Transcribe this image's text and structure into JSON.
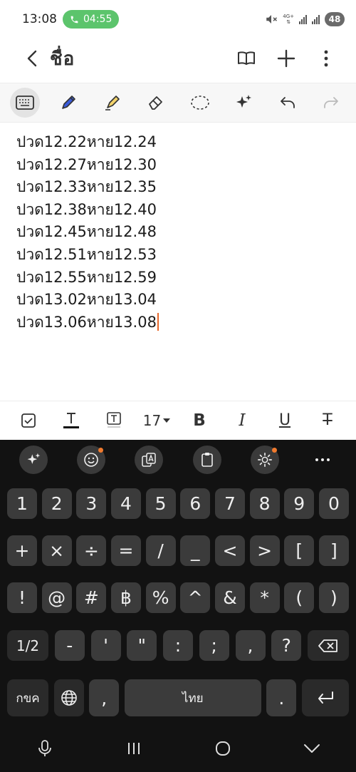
{
  "status_bar": {
    "time": "13:08",
    "call_timer": "04:55",
    "network": "4G+",
    "battery": "48"
  },
  "app_bar": {
    "title": "ชื่อ",
    "icons": [
      "back-icon",
      "book-icon",
      "plus-icon",
      "more-vertical-icon"
    ]
  },
  "pen_toolbar": {
    "tools": [
      "keyboard-icon",
      "pen-icon",
      "highlighter-icon",
      "eraser-icon",
      "lasso-icon",
      "ai-sparkle-icon",
      "undo-icon",
      "redo-icon"
    ],
    "active_tool": "keyboard-icon"
  },
  "note": {
    "lines": [
      "ปวด12.22หาย12.24",
      "ปวด12.27หาย12.30",
      "ปวด12.33หาย12.35",
      "ปวด12.38หาย12.40",
      "ปวด12.45หาย12.48",
      "ปวด12.51หาย12.53",
      "ปวด12.55หาย12.59",
      "ปวด13.02หาย13.04",
      "ปวด13.06หาย13.08"
    ],
    "cursor_color": "#e8682a"
  },
  "format_bar": {
    "font_size": "17",
    "bold": "B",
    "italic": "I",
    "underline": "U",
    "strike": "T"
  },
  "keyboard": {
    "toolbar": [
      "ai-sparkle-icon",
      "emoji-icon",
      "translate-icon",
      "clipboard-icon",
      "settings-icon",
      "more-horizontal-icon"
    ],
    "row1": [
      "1",
      "2",
      "3",
      "4",
      "5",
      "6",
      "7",
      "8",
      "9",
      "0"
    ],
    "row2": [
      "+",
      "×",
      "÷",
      "=",
      "/",
      "_",
      "<",
      ">",
      "[",
      "]"
    ],
    "row3": [
      "!",
      "@",
      "#",
      "฿",
      "%",
      "^",
      "&",
      "*",
      "(",
      ")"
    ],
    "row4": [
      "1/2",
      "-",
      "'",
      "\"",
      ":",
      ";",
      ",",
      "?"
    ],
    "row5": {
      "lang": "กขค",
      "comma": ",",
      "space": "ไทย",
      "period": "."
    },
    "accent": "#f07a2e"
  },
  "nav_bar": {
    "icons": [
      "mic-icon",
      "recents-icon",
      "home-icon",
      "back-chevron-icon"
    ]
  }
}
